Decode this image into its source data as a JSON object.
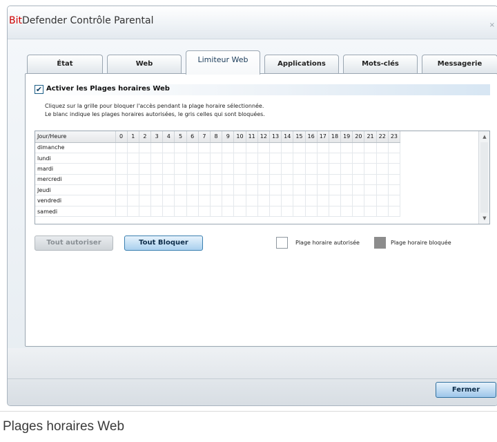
{
  "window": {
    "title_brand": "Bit",
    "title_rest": "Defender Contrôle Parental",
    "close_label": "×"
  },
  "tabs": [
    {
      "label": "État",
      "active": false
    },
    {
      "label": "Web",
      "active": false
    },
    {
      "label": "Limiteur Web",
      "active": true
    },
    {
      "label": "Applications",
      "active": false
    },
    {
      "label": "Mots-clés",
      "active": false
    },
    {
      "label": "Messagerie",
      "active": false
    }
  ],
  "section": {
    "checkbox_checked": true,
    "checkmark": "✔",
    "title": "Activer les Plages horaires Web",
    "hint_line1": "Cliquez sur la grille pour bloquer l'accès pendant la plage horaire sélectionnée.",
    "hint_line2": "Le blanc indique les plages horaires autorisées, le gris celles qui sont bloquées."
  },
  "grid": {
    "header_label": "Jour/Heure",
    "hours": [
      "0",
      "1",
      "2",
      "3",
      "4",
      "5",
      "6",
      "7",
      "8",
      "9",
      "10",
      "11",
      "12",
      "13",
      "14",
      "15",
      "16",
      "17",
      "18",
      "19",
      "20",
      "21",
      "22",
      "23"
    ],
    "days": [
      "dimanche",
      "lundi",
      "mardi",
      "mercredi",
      "Jeudi",
      "vendredi",
      "samedi"
    ],
    "scroll_up_icon": "▲",
    "scroll_down_icon": "▼"
  },
  "buttons": {
    "allow_all": "Tout autoriser",
    "block_all": "Tout Bloquer",
    "close": "Fermer"
  },
  "legend": {
    "allowed_label": "Plage horaire autorisée",
    "blocked_label": "Plage horaire bloquée",
    "allowed_color": "#ffffff",
    "blocked_color": "#8c8c8c"
  },
  "caption": "Plages horaires Web"
}
